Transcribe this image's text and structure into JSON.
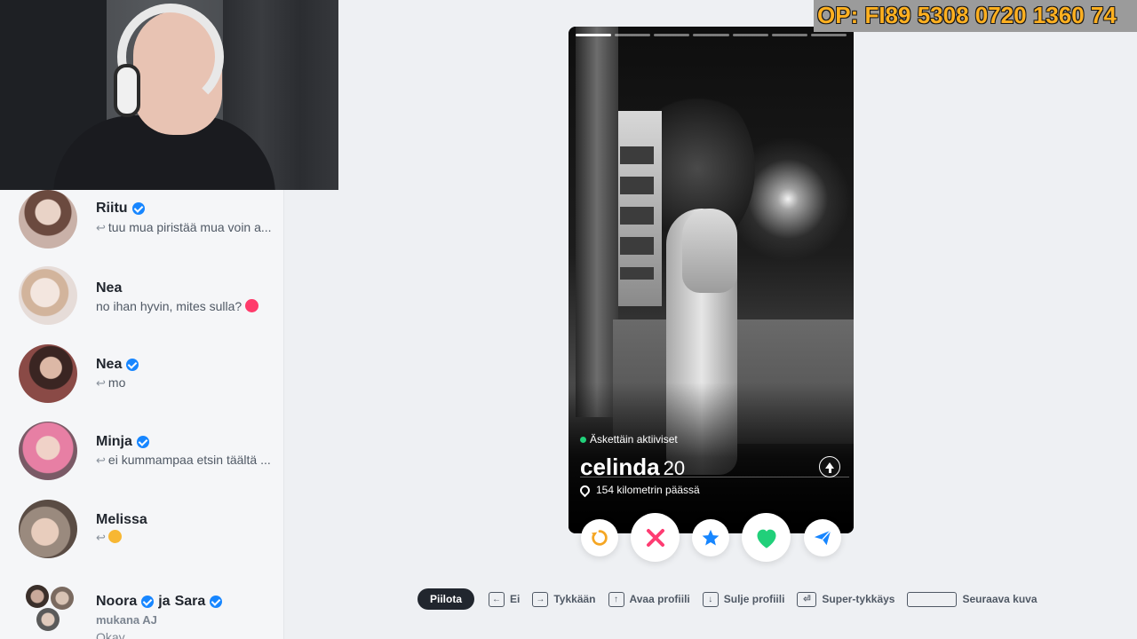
{
  "overlay": {
    "text": "OP: FI89 5308 0720 1360 74"
  },
  "chats": [
    {
      "name": "Riitu",
      "verified": true,
      "message": "tuu mua piristää mua voin a...",
      "reply": true,
      "avatar_color": "#c9b1a8"
    },
    {
      "name": "Nea",
      "verified": false,
      "message": "no ihan hyvin, mites sulla?",
      "reply": false,
      "emoji_color": "#ff3b6b",
      "avatar_color": "#d9c9c4"
    },
    {
      "name": "Nea",
      "verified": true,
      "message": "mo",
      "reply": true,
      "avatar_color": "#8a4a46"
    },
    {
      "name": "Minja",
      "verified": true,
      "message": "ei kummampaa etsin täältä ...",
      "reply": true,
      "avatar_color": "#e77fa4"
    },
    {
      "name": "Melissa",
      "verified": false,
      "message": "",
      "reply": true,
      "emoji_color": "#f7b733",
      "avatar_color": "#9a8a7e"
    },
    {
      "name": "Noora",
      "name2": "Sara",
      "joiner": "ja",
      "verified": true,
      "sub": "mukana AJ",
      "message": "Okay",
      "avatar_color": "#b7a89d"
    }
  ],
  "profile": {
    "status": "Äskettäin aktiiviset",
    "name": "celinda",
    "age": "20",
    "distance": "154 kilometrin päässä",
    "photo_count": 7,
    "active_photo": 0
  },
  "actions": {
    "rewind_color": "#f5a623",
    "nope_color": "#fe3c72",
    "superlike_color": "#1786ff",
    "like_color": "#21d07a",
    "boost_color": "#1786ff"
  },
  "hints": {
    "hide": "Piilota",
    "no": "Ei",
    "like": "Tykkään",
    "open_profile": "Avaa profiili",
    "close_profile": "Sulje profiili",
    "super_like": "Super-tykkäys",
    "next_photo": "Seuraava kuva"
  }
}
